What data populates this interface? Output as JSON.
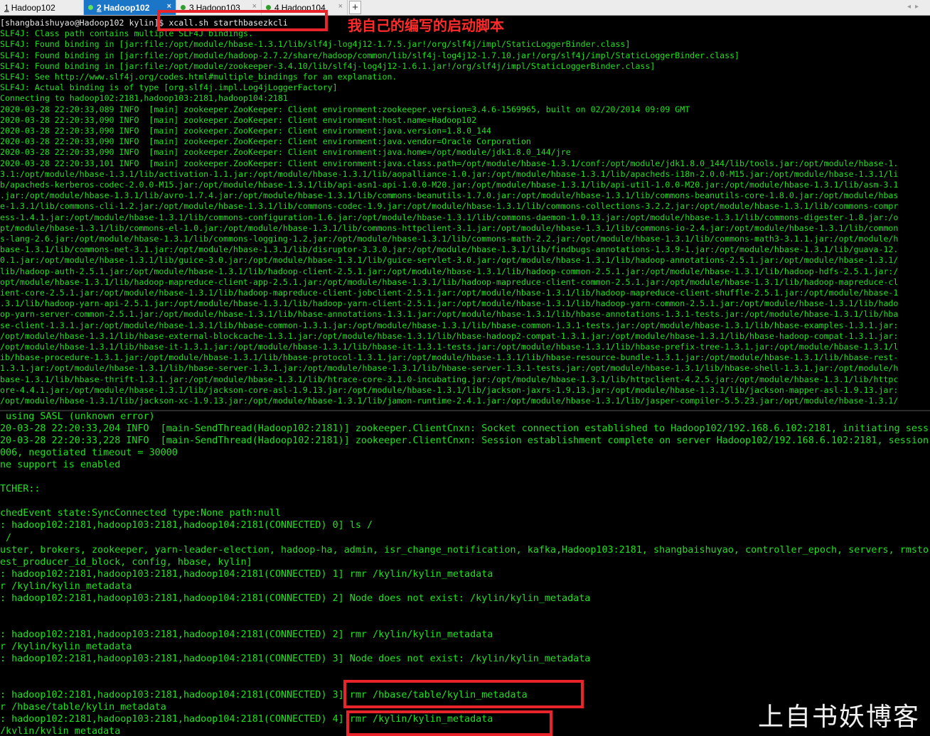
{
  "tabs": [
    {
      "num": "1",
      "label": "Hadoop102",
      "active": false
    },
    {
      "num": "2",
      "label": "Hadoop102",
      "active": true
    },
    {
      "num": "3",
      "label": "Hadoop103",
      "active": false
    },
    {
      "num": "4",
      "label": "Hadoop104",
      "active": false
    }
  ],
  "tab_close_glyph": "×",
  "add_tab_glyph": "+",
  "scroll_arrows": "◂▸",
  "annotation": "我自己的编写的启动脚本",
  "watermark": "上自书妖博客",
  "colors": {
    "terminal_green": "#20e020",
    "highlight_red": "#e8242a",
    "active_tab": "#1c76c7"
  },
  "top_pane": [
    "[shangbaishuyao@Hadoop102 kylin]$ xcall.sh starthbasezkcli",
    "SLF4J: Class path contains multiple SLF4J bindings.",
    "SLF4J: Found binding in [jar:file:/opt/module/hbase-1.3.1/lib/slf4j-log4j12-1.7.5.jar!/org/slf4j/impl/StaticLoggerBinder.class]",
    "SLF4J: Found binding in [jar:file:/opt/module/hadoop-2.7.2/share/hadoop/common/lib/slf4j-log4j12-1.7.10.jar!/org/slf4j/impl/StaticLoggerBinder.class]",
    "SLF4J: Found binding in [jar:file:/opt/module/zookeeper-3.4.10/lib/slf4j-log4j12-1.6.1.jar!/org/slf4j/impl/StaticLoggerBinder.class]",
    "SLF4J: See http://www.slf4j.org/codes.html#multiple_bindings for an explanation.",
    "SLF4J: Actual binding is of type [org.slf4j.impl.Log4jLoggerFactory]",
    "Connecting to hadoop102:2181,hadoop103:2181,hadoop104:2181",
    "2020-03-28 22:20:33,089 INFO  [main] zookeeper.ZooKeeper: Client environment:zookeeper.version=3.4.6-1569965, built on 02/20/2014 09:09 GMT",
    "2020-03-28 22:20:33,090 INFO  [main] zookeeper.ZooKeeper: Client environment:host.name=Hadoop102",
    "2020-03-28 22:20:33,090 INFO  [main] zookeeper.ZooKeeper: Client environment:java.version=1.8.0_144",
    "2020-03-28 22:20:33,090 INFO  [main] zookeeper.ZooKeeper: Client environment:java.vendor=Oracle Corporation",
    "2020-03-28 22:20:33,090 INFO  [main] zookeeper.ZooKeeper: Client environment:java.home=/opt/module/jdk1.8.0_144/jre",
    "2020-03-28 22:20:33,101 INFO  [main] zookeeper.ZooKeeper: Client environment:java.class.path=/opt/module/hbase-1.3.1/conf:/opt/module/jdk1.8.0_144/lib/tools.jar:/opt/module/hbase-1.",
    "3.1:/opt/module/hbase-1.3.1/lib/activation-1.1.jar:/opt/module/hbase-1.3.1/lib/aopalliance-1.0.jar:/opt/module/hbase-1.3.1/lib/apacheds-i18n-2.0.0-M15.jar:/opt/module/hbase-1.3.1/li",
    "b/apacheds-kerberos-codec-2.0.0-M15.jar:/opt/module/hbase-1.3.1/lib/api-asn1-api-1.0.0-M20.jar:/opt/module/hbase-1.3.1/lib/api-util-1.0.0-M20.jar:/opt/module/hbase-1.3.1/lib/asm-3.1",
    ".jar:/opt/module/hbase-1.3.1/lib/avro-1.7.4.jar:/opt/module/hbase-1.3.1/lib/commons-beanutils-1.7.0.jar:/opt/module/hbase-1.3.1/lib/commons-beanutils-core-1.8.0.jar:/opt/module/hbas",
    "e-1.3.1/lib/commons-cli-1.2.jar:/opt/module/hbase-1.3.1/lib/commons-codec-1.9.jar:/opt/module/hbase-1.3.1/lib/commons-collections-3.2.2.jar:/opt/module/hbase-1.3.1/lib/commons-compr",
    "ess-1.4.1.jar:/opt/module/hbase-1.3.1/lib/commons-configuration-1.6.jar:/opt/module/hbase-1.3.1/lib/commons-daemon-1.0.13.jar:/opt/module/hbase-1.3.1/lib/commons-digester-1.8.jar:/o",
    "pt/module/hbase-1.3.1/lib/commons-el-1.0.jar:/opt/module/hbase-1.3.1/lib/commons-httpclient-3.1.jar:/opt/module/hbase-1.3.1/lib/commons-io-2.4.jar:/opt/module/hbase-1.3.1/lib/common",
    "s-lang-2.6.jar:/opt/module/hbase-1.3.1/lib/commons-logging-1.2.jar:/opt/module/hbase-1.3.1/lib/commons-math-2.2.jar:/opt/module/hbase-1.3.1/lib/commons-math3-3.1.1.jar:/opt/module/h",
    "base-1.3.1/lib/commons-net-3.1.jar:/opt/module/hbase-1.3.1/lib/disruptor-3.3.0.jar:/opt/module/hbase-1.3.1/lib/findbugs-annotations-1.3.9-1.jar:/opt/module/hbase-1.3.1/lib/guava-12.",
    "0.1.jar:/opt/module/hbase-1.3.1/lib/guice-3.0.jar:/opt/module/hbase-1.3.1/lib/guice-servlet-3.0.jar:/opt/module/hbase-1.3.1/lib/hadoop-annotations-2.5.1.jar:/opt/module/hbase-1.3.1/",
    "lib/hadoop-auth-2.5.1.jar:/opt/module/hbase-1.3.1/lib/hadoop-client-2.5.1.jar:/opt/module/hbase-1.3.1/lib/hadoop-common-2.5.1.jar:/opt/module/hbase-1.3.1/lib/hadoop-hdfs-2.5.1.jar:/",
    "opt/module/hbase-1.3.1/lib/hadoop-mapreduce-client-app-2.5.1.jar:/opt/module/hbase-1.3.1/lib/hadoop-mapreduce-client-common-2.5.1.jar:/opt/module/hbase-1.3.1/lib/hadoop-mapreduce-cl",
    "ient-core-2.5.1.jar:/opt/module/hbase-1.3.1/lib/hadoop-mapreduce-client-jobclient-2.5.1.jar:/opt/module/hbase-1.3.1/lib/hadoop-mapreduce-client-shuffle-2.5.1.jar:/opt/module/hbase-1",
    ".3.1/lib/hadoop-yarn-api-2.5.1.jar:/opt/module/hbase-1.3.1/lib/hadoop-yarn-client-2.5.1.jar:/opt/module/hbase-1.3.1/lib/hadoop-yarn-common-2.5.1.jar:/opt/module/hbase-1.3.1/lib/hado",
    "op-yarn-server-common-2.5.1.jar:/opt/module/hbase-1.3.1/lib/hbase-annotations-1.3.1.jar:/opt/module/hbase-1.3.1/lib/hbase-annotations-1.3.1-tests.jar:/opt/module/hbase-1.3.1/lib/hba",
    "se-client-1.3.1.jar:/opt/module/hbase-1.3.1/lib/hbase-common-1.3.1.jar:/opt/module/hbase-1.3.1/lib/hbase-common-1.3.1-tests.jar:/opt/module/hbase-1.3.1/lib/hbase-examples-1.3.1.jar:",
    "/opt/module/hbase-1.3.1/lib/hbase-external-blockcache-1.3.1.jar:/opt/module/hbase-1.3.1/lib/hbase-hadoop2-compat-1.3.1.jar:/opt/module/hbase-1.3.1/lib/hbase-hadoop-compat-1.3.1.jar:",
    "/opt/module/hbase-1.3.1/lib/hbase-it-1.3.1.jar:/opt/module/hbase-1.3.1/lib/hbase-it-1.3.1-tests.jar:/opt/module/hbase-1.3.1/lib/hbase-prefix-tree-1.3.1.jar:/opt/module/hbase-1.3.1/l",
    "ib/hbase-procedure-1.3.1.jar:/opt/module/hbase-1.3.1/lib/hbase-protocol-1.3.1.jar:/opt/module/hbase-1.3.1/lib/hbase-resource-bundle-1.3.1.jar:/opt/module/hbase-1.3.1/lib/hbase-rest-",
    "1.3.1.jar:/opt/module/hbase-1.3.1/lib/hbase-server-1.3.1.jar:/opt/module/hbase-1.3.1/lib/hbase-server-1.3.1-tests.jar:/opt/module/hbase-1.3.1/lib/hbase-shell-1.3.1.jar:/opt/module/h",
    "base-1.3.1/lib/hbase-thrift-1.3.1.jar:/opt/module/hbase-1.3.1/lib/htrace-core-3.1.0-incubating.jar:/opt/module/hbase-1.3.1/lib/httpclient-4.2.5.jar:/opt/module/hbase-1.3.1/lib/httpc",
    "ore-4.4.1.jar:/opt/module/hbase-1.3.1/lib/jackson-core-asl-1.9.13.jar:/opt/module/hbase-1.3.1/lib/jackson-jaxrs-1.9.13.jar:/opt/module/hbase-1.3.1/lib/jackson-mapper-asl-1.9.13.jar:",
    "/opt/module/hbase-1.3.1/lib/jackson-xc-1.9.13.jar:/opt/module/hbase-1.3.1/lib/jamon-runtime-2.4.1.jar:/opt/module/hbase-1.3.1/lib/jasper-compiler-5.5.23.jar:/opt/module/hbase-1.3.1/"
  ],
  "bottom_pane": [
    " using SASL (unknown error)",
    "20-03-28 22:20:33,204 INFO  [main-SendThread(Hadoop102:2181)] zookeeper.ClientCnxn: Socket connection established to Hadoop102/192.168.6.102:2181, initiating sess",
    "20-03-28 22:20:33,228 INFO  [main-SendThread(Hadoop102:2181)] zookeeper.ClientCnxn: Session establishment complete on server Hadoop102/192.168.6.102:2181, session",
    "006, negotiated timeout = 30000",
    "ne support is enabled",
    "",
    "TCHER::",
    "",
    "chedEvent state:SyncConnected type:None path:null",
    ": hadoop102:2181,hadoop103:2181,hadoop104:2181(CONNECTED) 0] ls /",
    " /",
    "uster, brokers, zookeeper, yarn-leader-election, hadoop-ha, admin, isr_change_notification, kafka,Hadoop103:2181, shangbaishuyao, controller_epoch, servers, rmsto",
    "est_producer_id_block, config, hbase, kylin]",
    ": hadoop102:2181,hadoop103:2181,hadoop104:2181(CONNECTED) 1] rmr /kylin/kylin_metadata",
    "r /kylin/kylin_metadata",
    ": hadoop102:2181,hadoop103:2181,hadoop104:2181(CONNECTED) 2] Node does not exist: /kylin/kylin_metadata",
    "",
    "",
    ": hadoop102:2181,hadoop103:2181,hadoop104:2181(CONNECTED) 2] rmr /kylin/kylin_metadata",
    "r /kylin/kylin_metadata",
    ": hadoop102:2181,hadoop103:2181,hadoop104:2181(CONNECTED) 3] Node does not exist: /kylin/kylin_metadata",
    "",
    "",
    ": hadoop102:2181,hadoop103:2181,hadoop104:2181(CONNECTED) 3] rmr /hbase/table/kylin_metadata",
    "r /hbase/table/kylin_metadata",
    ": hadoop102:2181,hadoop103:2181,hadoop104:2181(CONNECTED) 4] rmr /kylin/kylin_metadata",
    "/kylin/kylin_metadata"
  ]
}
